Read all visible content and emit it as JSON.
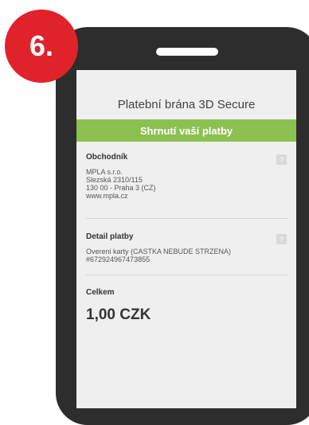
{
  "badge": {
    "label": "6."
  },
  "gateway": {
    "title": "Platební brána 3D Secure",
    "summary": "Shrnutí vaší platby"
  },
  "merchant": {
    "heading": "Obchodník",
    "help": "?",
    "lines": [
      "MPLA s.r.o.",
      "Slezská 2310/115",
      "130 00 - Praha 3 (CZ)",
      "www.mpla.cz"
    ]
  },
  "payment": {
    "heading": "Detail platby",
    "help": "?",
    "lines": [
      "Overeni karty (CASTKA NEBUDE STRZENA)",
      "#672924967473855"
    ]
  },
  "total": {
    "heading": "Celkem",
    "amount": "1,00 CZK"
  }
}
